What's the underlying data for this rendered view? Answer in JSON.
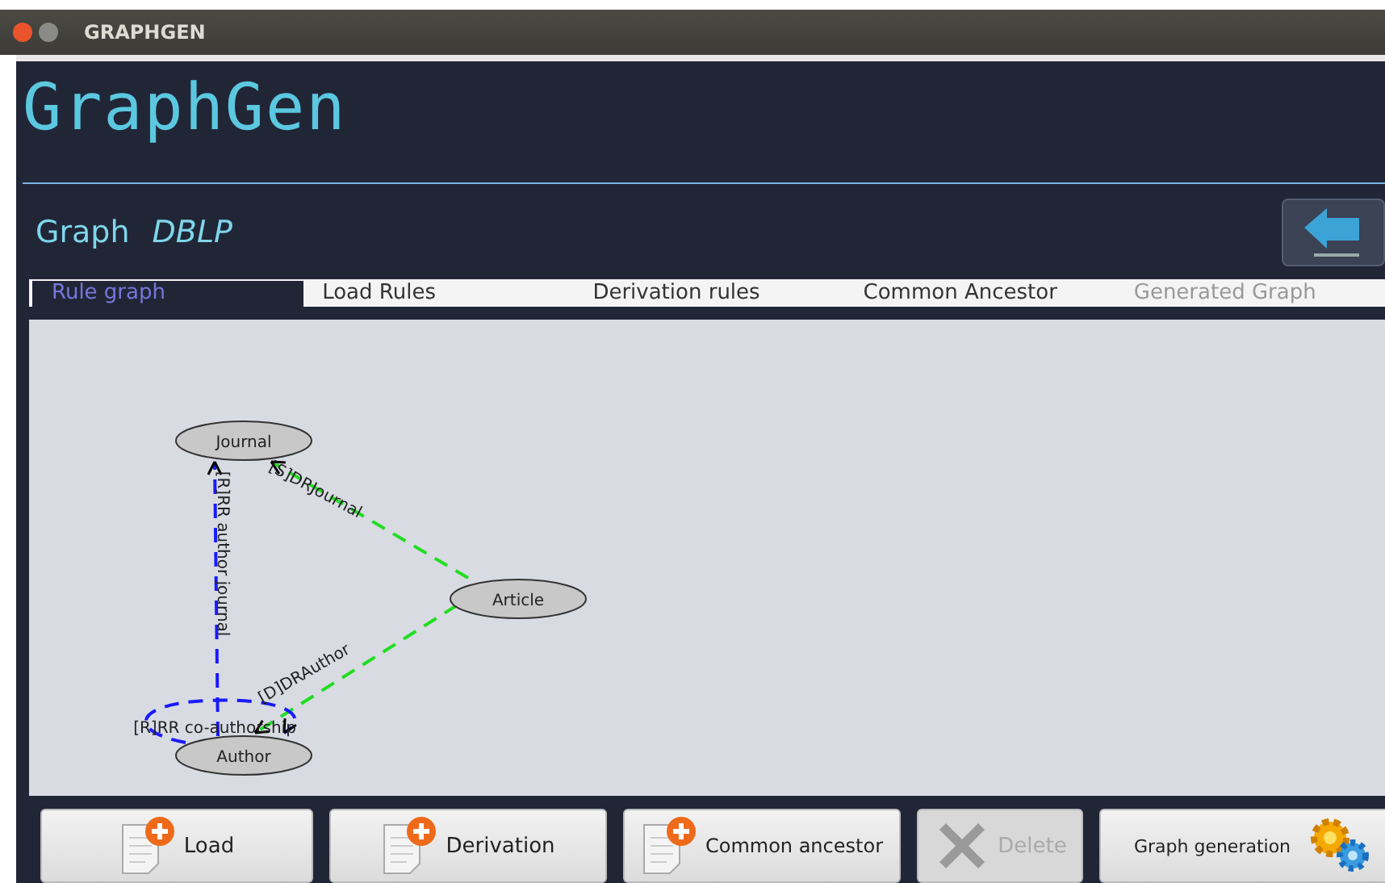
{
  "window": {
    "title": "GRAPHGEN"
  },
  "logo": "GraphGen",
  "graph": {
    "label": "Graph",
    "name": "DBLP"
  },
  "tabs": [
    {
      "label": "Rule graph",
      "selected": true,
      "disabled": false
    },
    {
      "label": "Load Rules",
      "selected": false,
      "disabled": false
    },
    {
      "label": "Derivation rules",
      "selected": false,
      "disabled": false
    },
    {
      "label": "Common Ancestor",
      "selected": false,
      "disabled": false
    },
    {
      "label": "Generated Graph",
      "selected": false,
      "disabled": true
    }
  ],
  "rule_graph": {
    "nodes": [
      {
        "label": "Journal"
      },
      {
        "label": "Article"
      },
      {
        "label": "Author"
      }
    ],
    "edges": [
      {
        "label": "[R]RR author journal",
        "color": "#1a1aff"
      },
      {
        "label": "[S]DRJournal",
        "color": "#22dd22"
      },
      {
        "label": "[D]DRAuthor",
        "color": "#22dd22"
      },
      {
        "label": "[R]RR co-authorship",
        "color": "#1a1aff"
      }
    ]
  },
  "buttons": [
    {
      "label": "Load",
      "kind": "add",
      "disabled": false
    },
    {
      "label": "Derivation",
      "kind": "add",
      "disabled": false
    },
    {
      "label": "Common ancestor",
      "kind": "add",
      "disabled": false
    },
    {
      "label": "Delete",
      "kind": "remove",
      "disabled": true
    },
    {
      "label": "Graph generation",
      "kind": "generate",
      "disabled": false
    }
  ]
}
